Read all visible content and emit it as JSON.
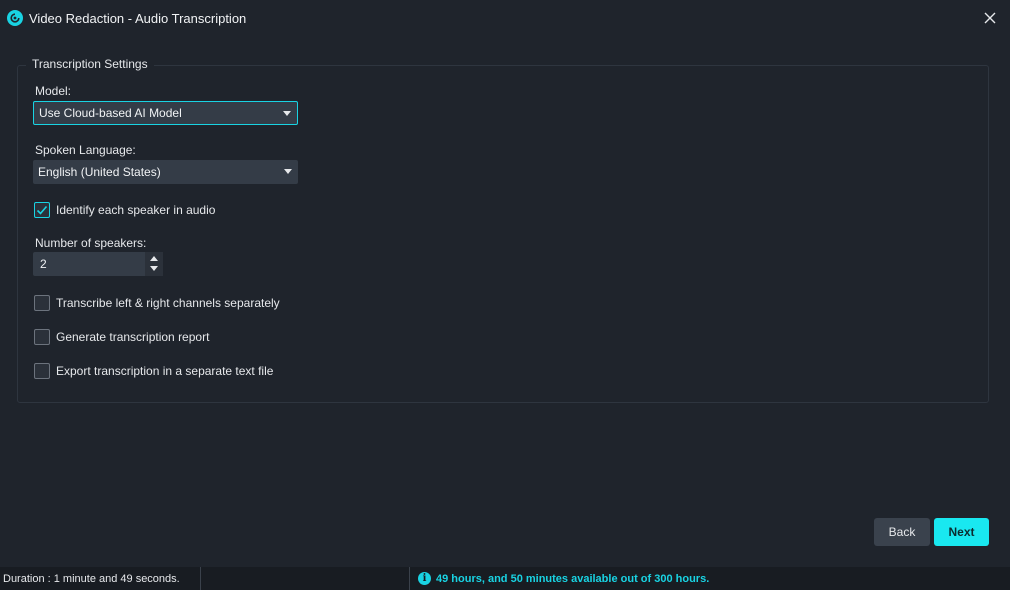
{
  "window": {
    "title": "Video Redaction - Audio Transcription",
    "app_icon": "app-logo-icon",
    "close_icon": "close-icon"
  },
  "settings": {
    "group_title": "Transcription Settings",
    "model": {
      "label": "Model:",
      "value": "Use Cloud-based AI Model"
    },
    "language": {
      "label": "Spoken Language:",
      "value": "English (United States)"
    },
    "identify_speakers": {
      "label": "Identify each speaker in audio",
      "checked": true
    },
    "num_speakers": {
      "label": "Number of speakers:",
      "value": "2"
    },
    "options": [
      {
        "label": "Transcribe left & right channels separately",
        "checked": false
      },
      {
        "label": "Generate transcription report",
        "checked": false
      },
      {
        "label": "Export transcription in a separate text file",
        "checked": false
      }
    ]
  },
  "buttons": {
    "back": "Back",
    "next": "Next"
  },
  "status": {
    "duration": "Duration : 1 minute and 49 seconds.",
    "available": "49 hours, and 50 minutes available out of 300 hours.",
    "info_icon": "i"
  },
  "colors": {
    "accent": "#19e8f0",
    "background": "#1f242c",
    "status_text": "#19d3e3"
  }
}
